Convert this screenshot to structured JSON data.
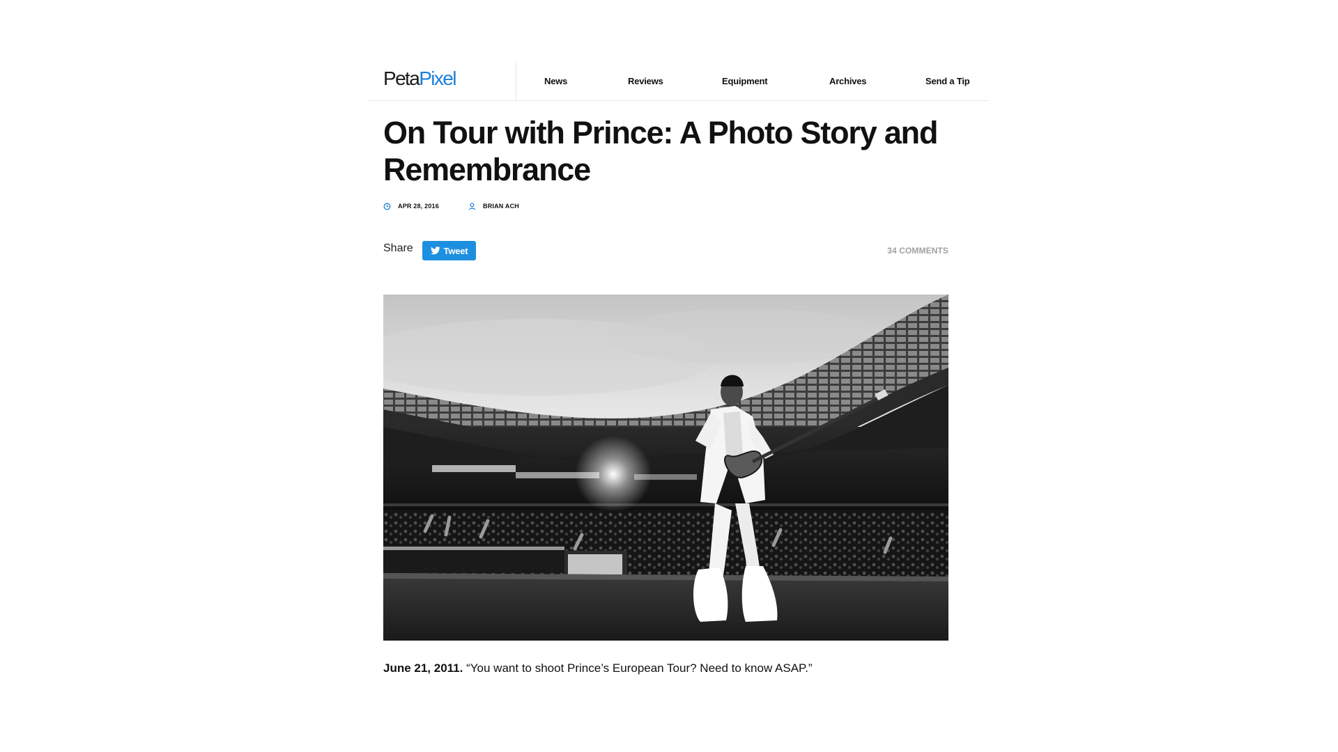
{
  "header": {
    "logo": {
      "part1": "Peta",
      "part2": "Pixel"
    },
    "nav": [
      {
        "label": "News"
      },
      {
        "label": "Reviews"
      },
      {
        "label": "Equipment"
      },
      {
        "label": "Archives"
      },
      {
        "label": "Send a Tip"
      }
    ]
  },
  "article": {
    "title": "On Tour with Prince: A Photo Story and Remembrance",
    "date": "APR 28, 2016",
    "author": "BRIAN ACH",
    "share_label": "Share",
    "tweet_label": "Tweet",
    "comments": "34 COMMENTS",
    "caption_date": "June 21, 2011.",
    "caption_text": "“You want to shoot Prince’s European Tour? Need to know ASAP.”"
  },
  "icons": {
    "date": "clock-icon",
    "author": "user-icon",
    "tweet": "twitter-bird-icon"
  },
  "colors": {
    "brand_blue": "#1c7fd9",
    "tweet_blue": "#1d8fe0",
    "muted_text": "#a0a0a0",
    "text": "#111111"
  }
}
